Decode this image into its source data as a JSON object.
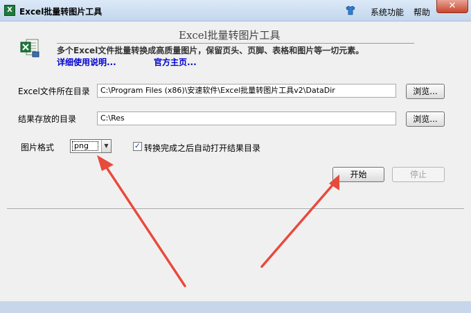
{
  "window": {
    "title": "Excel批量转图片工具",
    "menu": {
      "system": "系统功能",
      "help": "帮助"
    },
    "close_glyph": "✕"
  },
  "header": {
    "title": "Excel批量转图片工具",
    "description": "多个Excel文件批量转换成高质量图片，保留页头、页脚、表格和图片等一切元素。",
    "link_help": "详细使用说明...",
    "link_home": "官方主页..."
  },
  "form": {
    "dir_label": "Excel文件所在目录",
    "dir_value": "C:\\Program Files (x86)\\安速软件\\Excel批量转图片工具v2\\DataDir",
    "res_label": "结果存放的目录",
    "res_value": "C:\\Res",
    "browse_label": "浏览...",
    "format_label": "图片格式",
    "format_value": "png",
    "auto_open_label": "转换完成之后自动打开结果目录",
    "auto_open_checked": true,
    "start_label": "开始",
    "stop_label": "停止"
  },
  "icons": {
    "app": "excel-icon",
    "skin": "shirt-icon",
    "logo": "excel-logo-icon",
    "dropdown": "chevron-down-icon",
    "check": "check-icon"
  },
  "colors": {
    "link": "#0000cc",
    "arrow": "#e84a3c",
    "close": "#c9462c",
    "titlebar": "#c3d6ee"
  }
}
